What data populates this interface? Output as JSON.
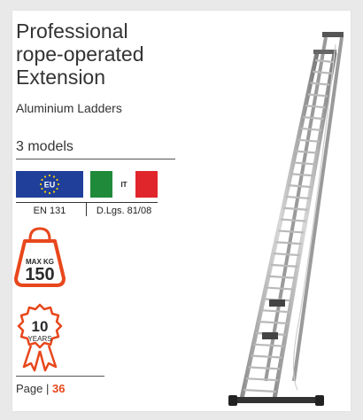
{
  "title": {
    "line1": "Professional",
    "line2": "rope-operated",
    "line3": "Extension"
  },
  "subtitle": "Aluminium Ladders",
  "models": "3 models",
  "certifications": [
    {
      "flag": "EU",
      "label": "EN 131",
      "flag_color": "#1f3f9a"
    },
    {
      "flag": "IT",
      "label": "D.Lgs. 81/08",
      "flag_colors": [
        "#1f8b3a",
        "#ffffff",
        "#e0262b"
      ]
    }
  ],
  "max_load": {
    "label": "MAX KG",
    "value": "150"
  },
  "warranty": {
    "value": "10",
    "unit": "YEARS"
  },
  "page": {
    "label": "Page | ",
    "number": "36"
  },
  "colors": {
    "accent": "#e8471c",
    "badge": "#e8471c"
  }
}
